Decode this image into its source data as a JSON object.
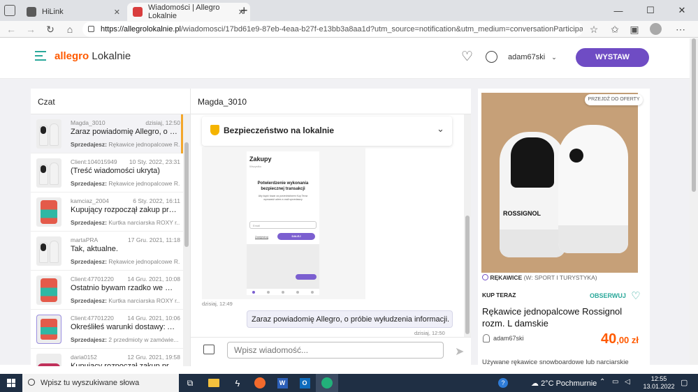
{
  "browser": {
    "tabs": [
      {
        "title": "HiLink",
        "color": "#4a4a4a"
      },
      {
        "title": "Wiadomości | Allegro Lokalnie",
        "color": "#d93d3d"
      }
    ],
    "new_tab": "+",
    "url_domain": "https://allegrolokalnie.pl",
    "url_path": "/wiadomosci/17bd61e9-87eb-4eaa-b27f-e13bb3a8aa1d?utm_source=notification&utm_medium=conversationParticipantMessageReceived&ut..."
  },
  "header": {
    "brand": "allegro",
    "brand_sub": "Lokalnie",
    "username": "adam67ski",
    "cta": "WYSTAW",
    "accent": "#6f4cc4",
    "brand_color": "#ff5a00"
  },
  "chatlist": {
    "title": "Czat",
    "rows": [
      {
        "name": "Magda_3010",
        "date": "dzisiaj, 12:50",
        "msg": "Zaraz powiadomię Allegro, o prób...",
        "label": "Sprzedajesz:",
        "item": "Rękawice jednopalcowe R...",
        "img": "glove",
        "active": true
      },
      {
        "name": "Client:104015949",
        "date": "10 Sty. 2022, 23:31",
        "msg": "(Treść wiadomości ukryta)",
        "label": "Sprzedajesz:",
        "item": "Rękawice jednopalcowe R...",
        "img": "glove"
      },
      {
        "name": "kamciaz_2004",
        "date": "6 Sty. 2022, 16:11",
        "msg": "Kupujący rozpoczął zakup przedm...",
        "label": "Sprzedajesz:",
        "item": "Kurtka narciarska ROXY r...",
        "img": "jacket"
      },
      {
        "name": "martaPRA",
        "date": "17 Gru. 2021, 11:18",
        "msg": "Tak, aktualne.",
        "label": "Sprzedajesz:",
        "item": "Rękawice jednopalcowe R...",
        "img": "glove"
      },
      {
        "name": "Client:47701220",
        "date": "14 Gru. 2021, 10:08",
        "msg": "Ostatnio bywam rzadko we Wrocł...",
        "label": "Sprzedajesz:",
        "item": "Kurtka narciarska ROXY r...",
        "img": "jacket"
      },
      {
        "name": "Client:47701220",
        "date": "14 Gru. 2021, 10:06",
        "msg": "Określiłeś warunki dostawy: Alleg...",
        "label": "Sprzedajesz:",
        "item": "2 przedmioty w zamówie...",
        "img": "stack"
      },
      {
        "name": "daria0152",
        "date": "12 Gru. 2021, 19:58",
        "msg": "Kupujący rozpoczął zakup przedm...",
        "label": "",
        "item": "",
        "img": "car"
      }
    ]
  },
  "conversation": {
    "partner": "Magda_3010",
    "safety_title": "Bezpieczeństwo na lokalnie",
    "shot": {
      "title": "Zakupy",
      "subtitle": "Wszystko",
      "heading": "Potwierdzenie wykonania bezpiecznej transakcji",
      "body": "Aby kupić towar za pośrednictwem Kup Teraz wprowadź adres e-mail sprzedawcy",
      "input": "Email",
      "link": "Zarejestruj",
      "button": "DALEJ"
    },
    "time1": "dzisiaj, 12:49",
    "bubble": "Zaraz powiadomię Allegro, o próbie wyłudzenia informacji.",
    "time2": "dzisiaj, 12:50",
    "placeholder": "Wpisz wiadomość..."
  },
  "offer": {
    "goto": "PRZEJDŹ DO OFERTY",
    "category": "RĘKAWICE",
    "category_path": "(W: SPORT I TURYSTYKA)",
    "buy_now": "KUP TERAZ",
    "watch": "OBSERWUJ",
    "title": "Rękawice jednopalcowe Rossignol rozm. L damskie",
    "seller": "adam67ski",
    "price_int": "40",
    "price_dec": ",00 zł",
    "desc": "Używane rękawice snowboardowe lub narciarskie",
    "glove_brand": "ROSSIGNOL",
    "price_color": "#ff5a00",
    "watch_color": "#2aa89a"
  },
  "taskbar": {
    "search": "Wpisz tu wyszukiwane słowa",
    "weather": "2°C Pochmurnie",
    "time": "12:55",
    "date": "13.01.2022"
  }
}
